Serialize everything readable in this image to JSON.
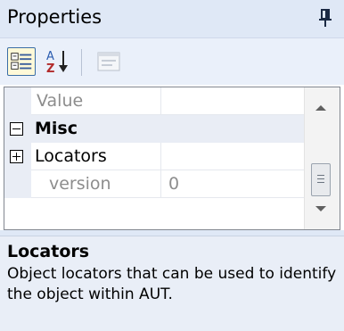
{
  "window": {
    "title": "Properties",
    "pin_icon": "pushpin-icon"
  },
  "toolbar": {
    "buttons": [
      {
        "icon": "categorized-icon",
        "tooltip": "",
        "active": true
      },
      {
        "icon": "sort-alphabetical-icon",
        "active": false
      },
      {
        "icon": "property-pages-icon",
        "active": false,
        "disabled": true
      }
    ]
  },
  "grid": {
    "header": {
      "name": "",
      "value": "Value"
    },
    "rows": [
      {
        "type": "category",
        "expander": "collapse",
        "name": "Misc"
      },
      {
        "type": "property",
        "expander": "expand",
        "name": "Locators",
        "value": ""
      },
      {
        "type": "property",
        "name": "version",
        "value": "0",
        "readonly": true
      }
    ]
  },
  "description": {
    "title": "Locators",
    "text": "Object locators that can be used to identify the object within AUT."
  },
  "colors": {
    "title_bar": "#dfe8f6",
    "toolbar": "#eaf0fa",
    "category_row": "#e9edf5",
    "description_bg": "#e9eef7",
    "readonly_text": "#8d8d8d"
  }
}
